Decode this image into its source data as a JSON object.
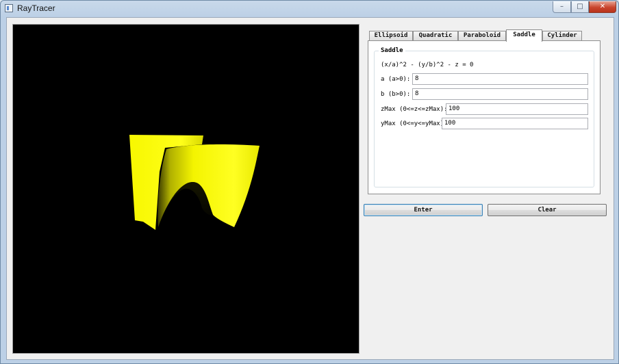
{
  "window": {
    "title": "RayTracer",
    "controls": {
      "minimize": "–",
      "maximize": "□",
      "close": "✕"
    }
  },
  "viewport": {
    "background": "#000000",
    "object": "saddle surface",
    "object_color": "#ffff00"
  },
  "tabs": [
    {
      "label": "Ellipsoid",
      "active": false
    },
    {
      "label": "Quadratic",
      "active": false
    },
    {
      "label": "Paraboloid",
      "active": false
    },
    {
      "label": "Saddle",
      "active": true
    },
    {
      "label": "Cylinder",
      "active": false
    }
  ],
  "panel": {
    "group_title": "Saddle",
    "equation": "(x/a)^2 - (y/b)^2 - z = 0",
    "fields": [
      {
        "label": "a (a>0):",
        "value": "8"
      },
      {
        "label": "b (b>0):",
        "value": "8"
      },
      {
        "label": "zMax (0<=z<=zMax):",
        "value": "100"
      },
      {
        "label": "yMax (0<=y<=yMax)",
        "value": "100"
      }
    ]
  },
  "buttons": {
    "enter": "Enter",
    "clear": "Clear"
  }
}
